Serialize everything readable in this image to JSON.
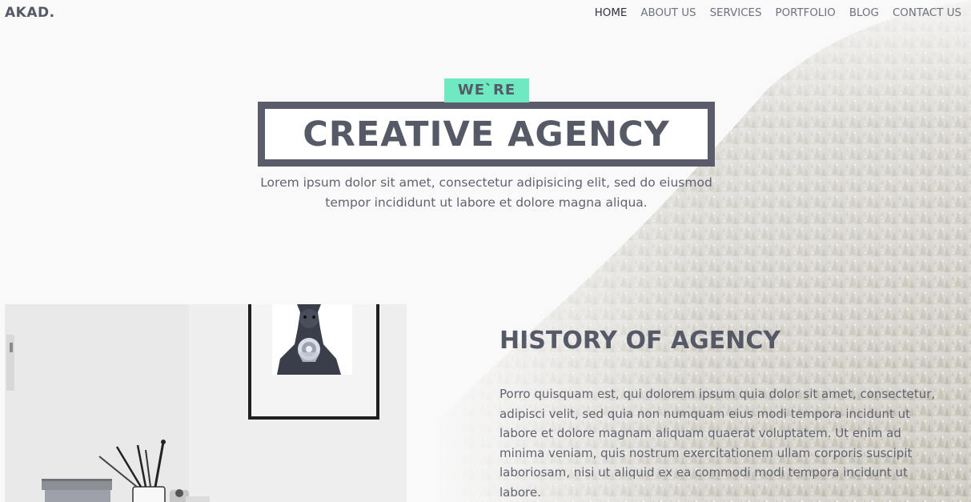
{
  "header": {
    "logo": "AKAD.",
    "nav": [
      {
        "label": "HOME",
        "active": true
      },
      {
        "label": "ABOUT US",
        "active": false
      },
      {
        "label": "SERVICES",
        "active": false
      },
      {
        "label": "PORTFOLIO",
        "active": false
      },
      {
        "label": "BLOG",
        "active": false
      },
      {
        "label": "CONTACT US",
        "active": false
      }
    ]
  },
  "hero": {
    "badge": "WE`RE",
    "title": "CREATIVE AGENCY",
    "text": "Lorem ipsum dolor sit amet, consectetur adipisicing elit, sed do eiusmod tempor incididunt ut labore et dolore magna aliqua."
  },
  "history": {
    "title": "HISTORY OF AGENCY",
    "text": "Porro quisquam est, qui dolorem ipsum quia dolor sit amet, consectetur, adipisci velit, sed quia non numquam eius modi tempora incidunt ut labore et dolore magnam aliquam quaerat voluptatem. Ut enim ad minima veniam, quis nostrum exercitationem ullam corporis suscipit laboriosam, nisi ut aliquid ex ea commodi modi tempora incidunt ut labore."
  },
  "colors": {
    "accent": "#6fe9c2",
    "text": "#555a66",
    "frame": "#5a5c6c"
  },
  "images": {
    "background": "misty-forest-hillside",
    "about": "desk-with-bear-art-print"
  }
}
